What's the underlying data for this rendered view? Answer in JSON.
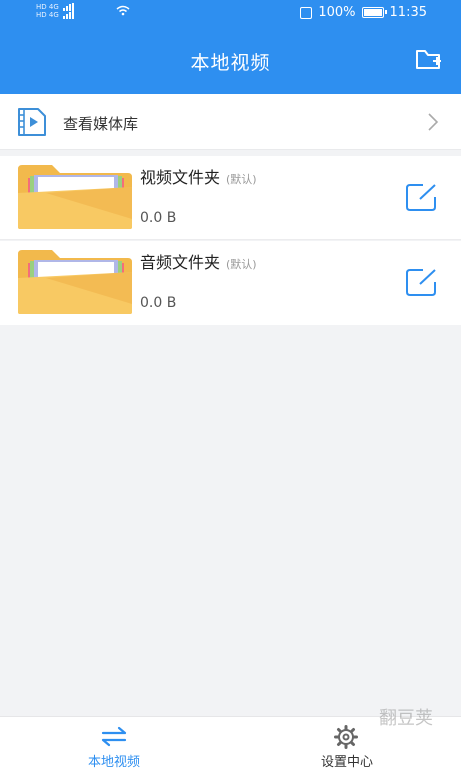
{
  "status_bar": {
    "net_line1": "HD 4G",
    "net_line2": "HD 4G",
    "battery": "100%",
    "time": "11:35"
  },
  "header": {
    "title": "本地视频",
    "new_folder_icon": "folder-plus-icon"
  },
  "media_library": {
    "label": "查看媒体库",
    "icon": "video-file-icon"
  },
  "folders": [
    {
      "name": "视频文件夹",
      "tag": "(默认)",
      "size": "0.0 B"
    },
    {
      "name": "音频文件夹",
      "tag": "(默认)",
      "size": "0.0 B"
    }
  ],
  "bottom_nav": {
    "items": [
      {
        "label": "本地视频",
        "icon": "swap-arrows-icon",
        "active": true
      },
      {
        "label": "设置中心",
        "icon": "gear-icon",
        "active": false
      }
    ]
  },
  "watermark": "翻豆荚",
  "colors": {
    "accent": "#2e8ff0",
    "folder": "#f7c35f"
  }
}
